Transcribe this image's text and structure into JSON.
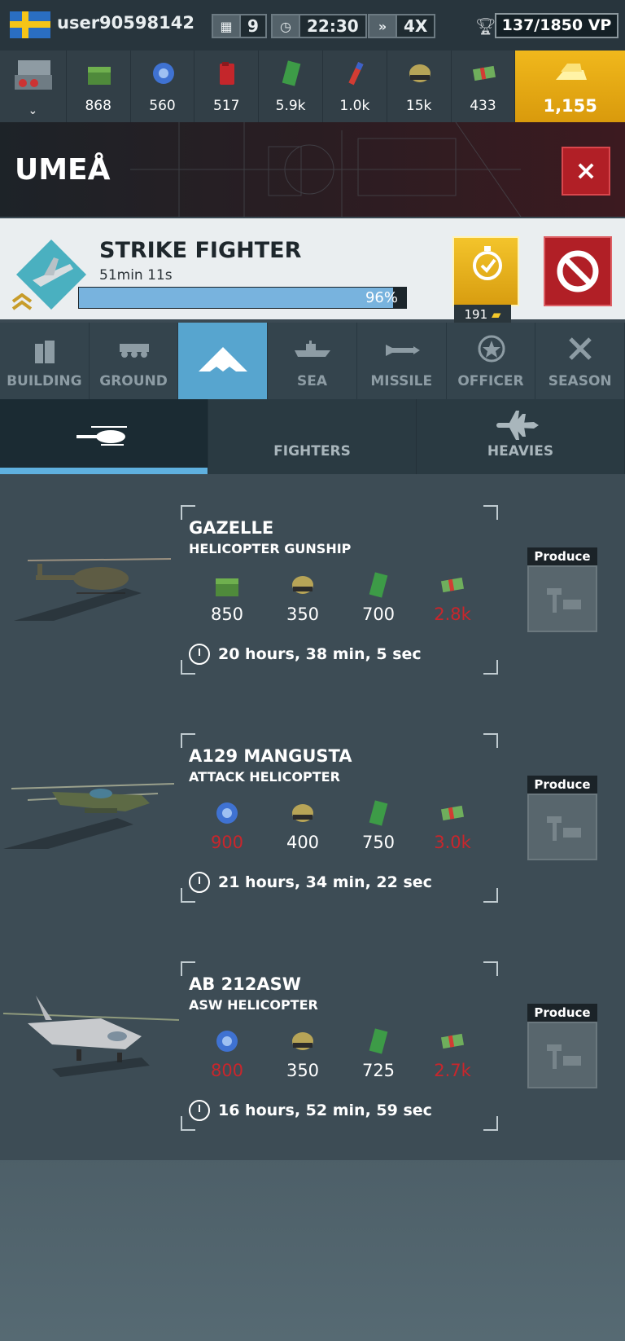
{
  "topbar": {
    "flag": "sweden-flag",
    "username": "user90598142",
    "days": "9",
    "clock": "22:30",
    "speed": "4X",
    "vp": "137/1850 VP"
  },
  "resources": [
    {
      "icon": "supplies-icon",
      "value": "868"
    },
    {
      "icon": "components-icon",
      "value": "560"
    },
    {
      "icon": "fuel-icon",
      "value": "517"
    },
    {
      "icon": "electronics-icon",
      "value": "5.9k"
    },
    {
      "icon": "rare-materials-icon",
      "value": "1.0k"
    },
    {
      "icon": "manpower-icon",
      "value": "15k"
    },
    {
      "icon": "cash-icon",
      "value": "433"
    }
  ],
  "gold": "1,155",
  "location": {
    "title": "UMEÅ",
    "close": "×"
  },
  "queue": {
    "name": "STRIKE FIGHTER",
    "time": "51min 11s",
    "progress_pct": 96,
    "progress_label": "96%",
    "speedup_cost": "191"
  },
  "categories": [
    {
      "key": "building",
      "label": "BUILDING"
    },
    {
      "key": "ground",
      "label": "GROUND"
    },
    {
      "key": "air",
      "label": ""
    },
    {
      "key": "sea",
      "label": "SEA"
    },
    {
      "key": "missile",
      "label": "MISSILE"
    },
    {
      "key": "officer",
      "label": "OFFICER"
    },
    {
      "key": "season",
      "label": "SEASON"
    }
  ],
  "subtabs": [
    {
      "key": "helicopters",
      "label": ""
    },
    {
      "key": "fighters",
      "label": "FIGHTERS"
    },
    {
      "key": "heavies",
      "label": "HEAVIES"
    }
  ],
  "units": [
    {
      "name": "GAZELLE",
      "type": "HELICOPTER GUNSHIP",
      "costs": [
        {
          "icon": "supplies-icon",
          "value": "850",
          "insufficient": false
        },
        {
          "icon": "manpower-icon",
          "value": "350",
          "insufficient": false
        },
        {
          "icon": "electronics-icon",
          "value": "700",
          "insufficient": false
        },
        {
          "icon": "cash-icon",
          "value": "2.8k",
          "insufficient": true
        }
      ],
      "time": "20 hours, 38 min, 5 sec",
      "produce_label": "Produce"
    },
    {
      "name": "A129 MANGUSTA",
      "type": "ATTACK HELICOPTER",
      "costs": [
        {
          "icon": "components-icon",
          "value": "900",
          "insufficient": true
        },
        {
          "icon": "manpower-icon",
          "value": "400",
          "insufficient": false
        },
        {
          "icon": "electronics-icon",
          "value": "750",
          "insufficient": false
        },
        {
          "icon": "cash-icon",
          "value": "3.0k",
          "insufficient": true
        }
      ],
      "time": "21 hours, 34 min, 22 sec",
      "produce_label": "Produce"
    },
    {
      "name": "AB 212ASW",
      "type": "ASW HELICOPTER",
      "costs": [
        {
          "icon": "components-icon",
          "value": "800",
          "insufficient": true
        },
        {
          "icon": "manpower-icon",
          "value": "350",
          "insufficient": false
        },
        {
          "icon": "electronics-icon",
          "value": "725",
          "insufficient": false
        },
        {
          "icon": "cash-icon",
          "value": "2.7k",
          "insufficient": true
        }
      ],
      "time": "16 hours, 52 min, 59 sec",
      "produce_label": "Produce"
    }
  ]
}
